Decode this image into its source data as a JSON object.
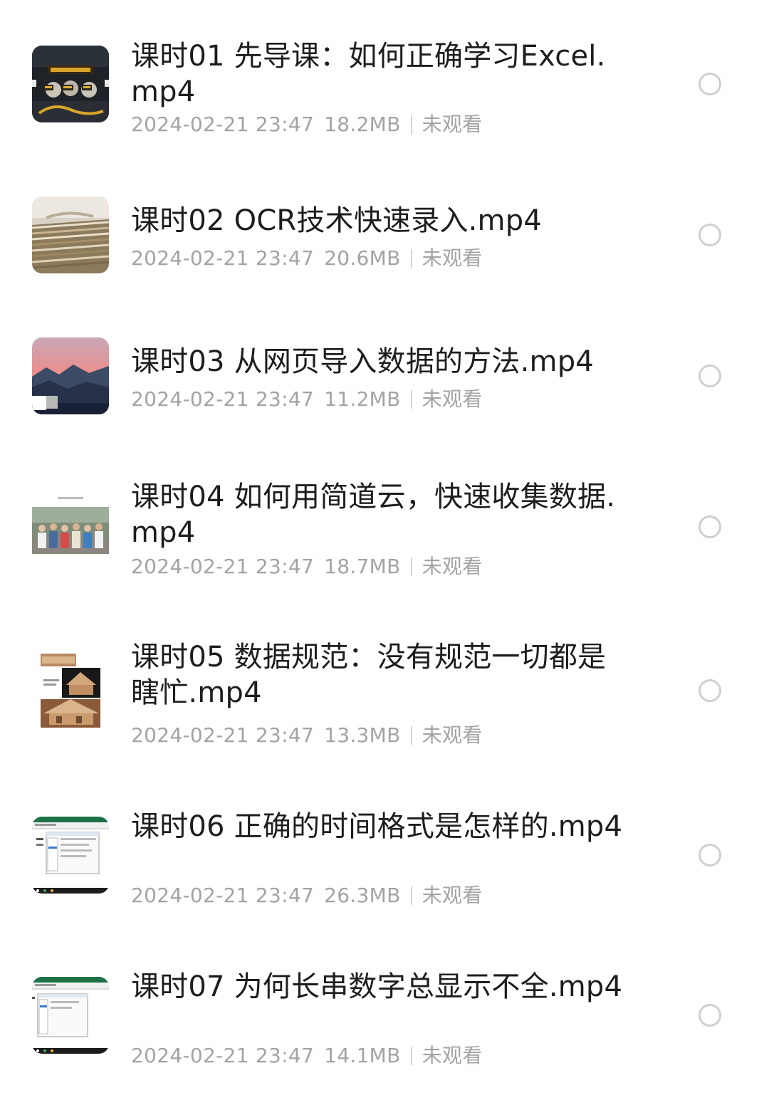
{
  "videos": [
    {
      "title": "课时01 先导课：如何正确学习Excel.mp4",
      "date": "2024-02-21 23:47",
      "size": "18.2MB",
      "status": "未观看",
      "thumbnail_icon": "presentation-thumbnail-icon"
    },
    {
      "title": "课时02 OCR技术快速录入.mp4",
      "date": "2024-02-21 23:47",
      "size": "20.6MB",
      "status": "未观看",
      "thumbnail_icon": "paper-stack-thumbnail-icon"
    },
    {
      "title": "课时03 从网页导入数据的方法.mp4",
      "date": "2024-02-21 23:47",
      "size": "11.2MB",
      "status": "未观看",
      "thumbnail_icon": "sunset-landscape-thumbnail-icon"
    },
    {
      "title": "课时04 如何用简道云，快速收集数据.mp4",
      "date": "2024-02-21 23:47",
      "size": "18.7MB",
      "status": "未观看",
      "thumbnail_icon": "group-photo-thumbnail-icon"
    },
    {
      "title": "课时05 数据规范：没有规范一切都是瞎忙.mp4",
      "date": "2024-02-21 23:47",
      "size": "13.3MB",
      "status": "未观看",
      "thumbnail_icon": "wooden-house-thumbnail-icon"
    },
    {
      "title": "课时06 正确的时间格式是怎样的.mp4",
      "date": "2024-02-21 23:47",
      "size": "26.3MB",
      "status": "未观看",
      "thumbnail_icon": "excel-window-thumbnail-icon"
    },
    {
      "title": "课时07 为何长串数字总显示不全.mp4",
      "date": "2024-02-21 23:47",
      "size": "14.1MB",
      "status": "未观看",
      "thumbnail_icon": "excel-window-thumbnail-icon"
    }
  ],
  "colors": {
    "title": "#1d1d1d",
    "meta": "#a3a3a3",
    "radio_border": "#cfcfcf",
    "background": "#ffffff"
  }
}
